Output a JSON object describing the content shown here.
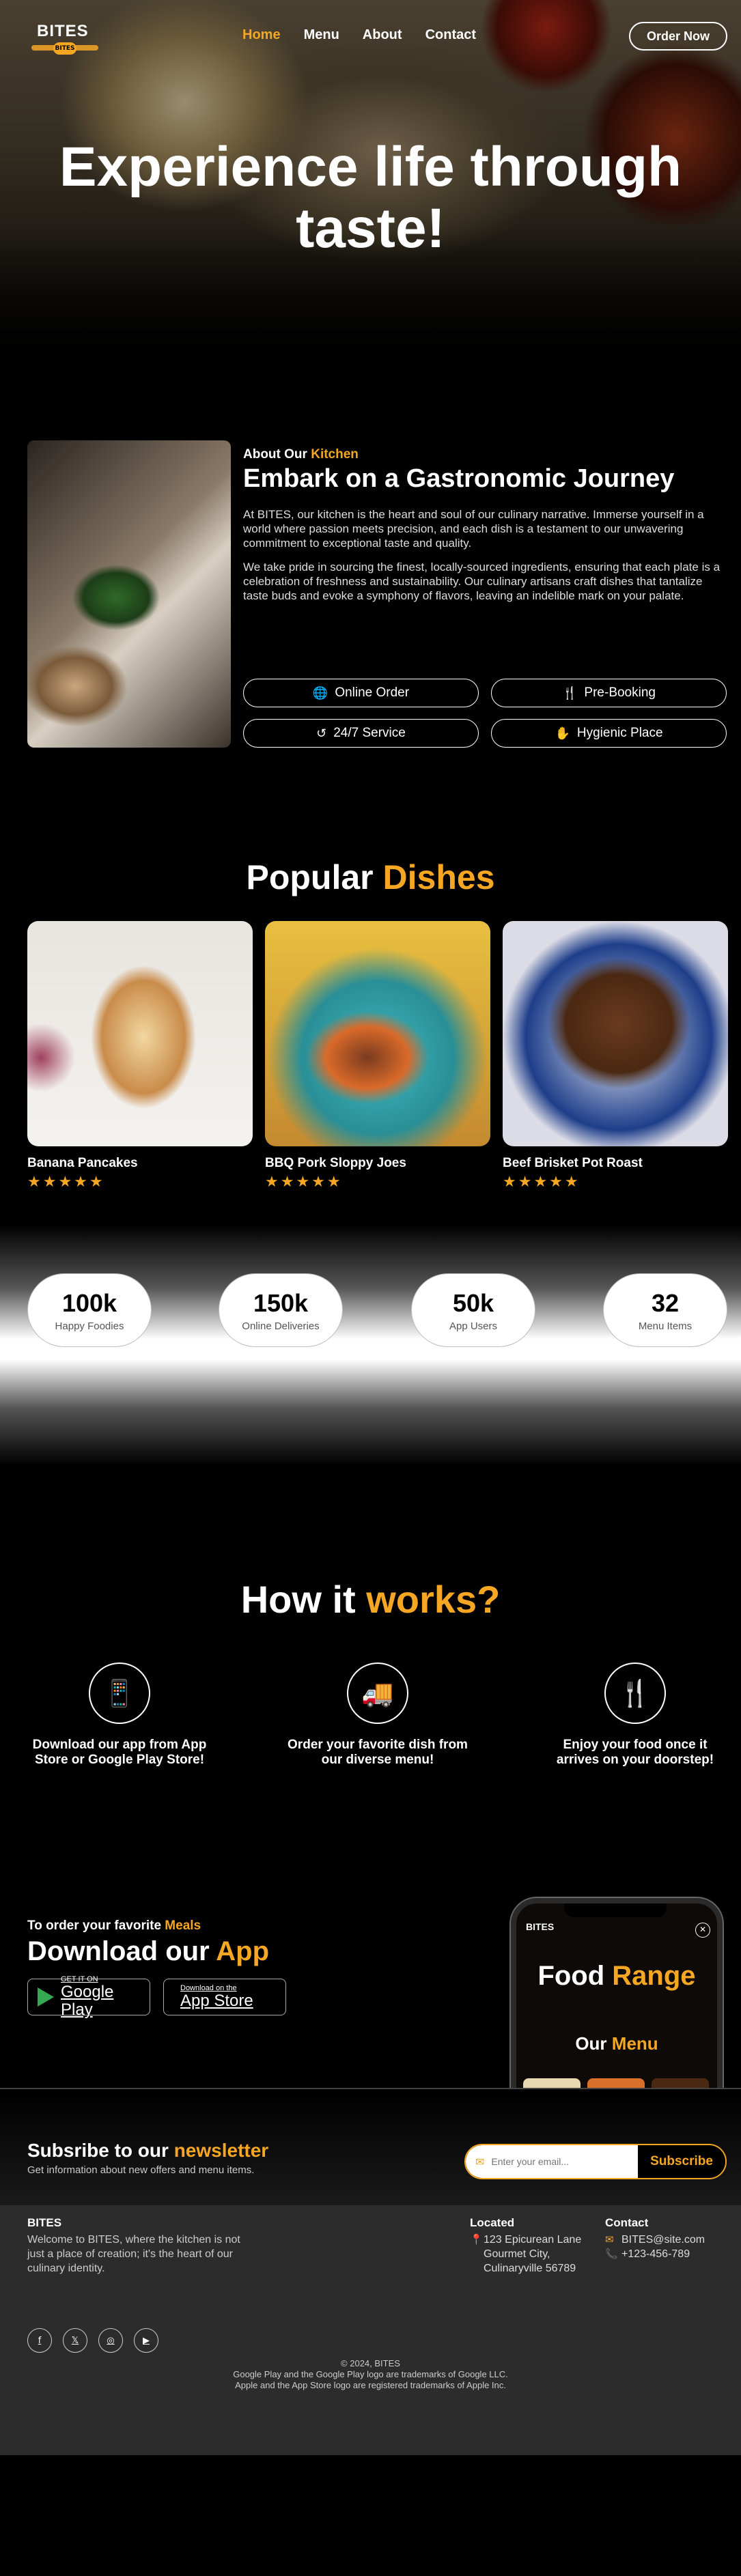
{
  "brand": {
    "logo_text": "BITES",
    "logo_badge": "BITES"
  },
  "nav": {
    "links": [
      "Home",
      "Menu",
      "About",
      "Contact"
    ],
    "order_button": "Order Now"
  },
  "hero": {
    "title": "Experience life through taste!"
  },
  "about": {
    "label_prefix": "About Our",
    "label_accent": "Kitchen",
    "heading": "Embark on a Gastronomic Journey",
    "paragraph1": "At BITES, our kitchen is the heart and soul of our culinary narrative. Immerse yourself in a world where passion meets precision, and each dish is a testament to our unwavering commitment to exceptional taste and quality.",
    "paragraph2": "We take pride in sourcing the finest, locally-sourced ingredients, ensuring that each plate is a celebration of freshness and sustainability. Our culinary artisans craft dishes that tantalize taste buds and evoke a symphony of flavors, leaving an indelible mark on your palate.",
    "features": [
      {
        "label": "Online Order",
        "icon": "globe-icon"
      },
      {
        "label": "Pre-Booking",
        "icon": "utensils-icon"
      },
      {
        "label": "24/7 Service",
        "icon": "history-icon"
      },
      {
        "label": "Hygienic Place",
        "icon": "hand-wash-icon"
      }
    ]
  },
  "popular": {
    "title_prefix": "Popular",
    "title_accent": "Dishes",
    "dishes": [
      {
        "name": "Banana Pancakes",
        "rating": 5
      },
      {
        "name": "BBQ Pork Sloppy Joes",
        "rating": 5
      },
      {
        "name": "Beef Brisket Pot Roast",
        "rating": 5
      }
    ]
  },
  "stats": [
    {
      "value": "100k",
      "label": "Happy Foodies"
    },
    {
      "value": "150k",
      "label": "Online Deliveries"
    },
    {
      "value": "50k",
      "label": "App Users"
    },
    {
      "value": "32",
      "label": "Menu Items"
    }
  ],
  "how": {
    "title_prefix": "How it",
    "title_accent": "works?",
    "steps": [
      {
        "text": "Download our app from App Store or Google Play Store!",
        "icon": "mobile-icon"
      },
      {
        "text": "Order your favorite dish from our diverse menu!",
        "icon": "delivery-truck-icon"
      },
      {
        "text": "Enjoy your food once it arrives on your doorstep!",
        "icon": "utensils-icon"
      }
    ]
  },
  "download": {
    "pre_prefix": "To order your favorite",
    "pre_accent": "Meals",
    "title_prefix": "Download our",
    "title_accent": "App",
    "google_small": "GET IT ON",
    "google_big": "Google Play",
    "apple_small": "Download on the",
    "apple_big": "App Store",
    "phone": {
      "logo": "BITES",
      "title_prefix": "Food",
      "title_accent": "Range",
      "menu_prefix": "Our",
      "menu_accent": "Menu"
    }
  },
  "newsletter": {
    "title_prefix": "Subsribe to our",
    "title_accent": "newsletter",
    "subtitle": "Get information about new offers and menu items.",
    "placeholder": "Enter your email...",
    "button": "Subscribe"
  },
  "footer": {
    "brand": "BITES",
    "description": "Welcome to BITES, where the kitchen is not just a place of creation; it's the heart of our culinary identity.",
    "located_heading": "Located",
    "address_lines": [
      "123 Epicurean Lane",
      "Gourmet City,",
      "Culinaryville 56789"
    ],
    "contact_heading": "Contact",
    "email": "BITES@site.com",
    "phone": "+123-456-789",
    "socials": [
      "facebook-icon",
      "x-icon",
      "instagram-icon",
      "youtube-icon"
    ],
    "legal": [
      "© 2024, BITES",
      "Google Play and the Google Play logo are trademarks of Google LLC.",
      "Apple and the App Store logo are registered trademarks of Apple Inc."
    ]
  },
  "colors": {
    "accent": "#f5a623",
    "background": "#000000",
    "footer": "#2c2c2c"
  }
}
